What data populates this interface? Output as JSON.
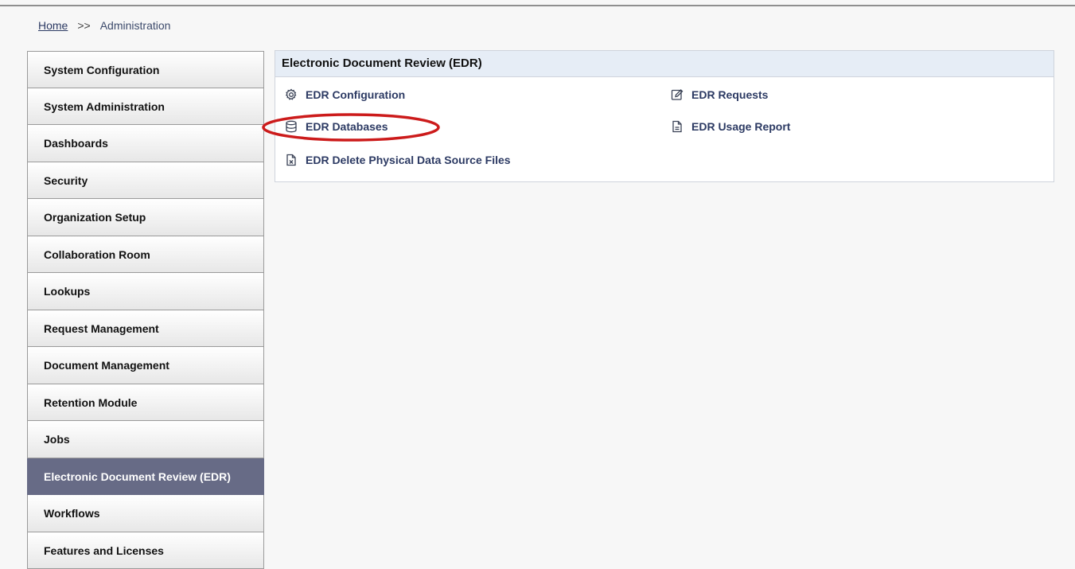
{
  "breadcrumb": {
    "home": "Home",
    "separator": ">>",
    "current": "Administration"
  },
  "sidebar": {
    "active_color": "#676b86",
    "items": [
      {
        "label": "System Configuration"
      },
      {
        "label": "System Administration"
      },
      {
        "label": "Dashboards"
      },
      {
        "label": "Security"
      },
      {
        "label": "Organization Setup"
      },
      {
        "label": "Collaboration Room"
      },
      {
        "label": "Lookups"
      },
      {
        "label": "Request Management"
      },
      {
        "label": "Document Management"
      },
      {
        "label": "Retention Module"
      },
      {
        "label": "Jobs"
      },
      {
        "label": "Electronic Document Review (EDR)",
        "active": true
      },
      {
        "label": "Workflows"
      },
      {
        "label": "Features and Licenses"
      }
    ]
  },
  "panel": {
    "title": "Electronic Document Review (EDR)",
    "links": [
      {
        "label": "EDR Configuration",
        "icon": "gear-icon"
      },
      {
        "label": "EDR Requests",
        "icon": "edit-icon"
      },
      {
        "label": "EDR Databases",
        "icon": "database-icon",
        "highlighted": true
      },
      {
        "label": "EDR Usage Report",
        "icon": "report-icon"
      },
      {
        "label": "EDR Delete Physical Data Source Files",
        "icon": "delete-file-icon"
      }
    ]
  },
  "highlight_color": "#cc1b1b"
}
